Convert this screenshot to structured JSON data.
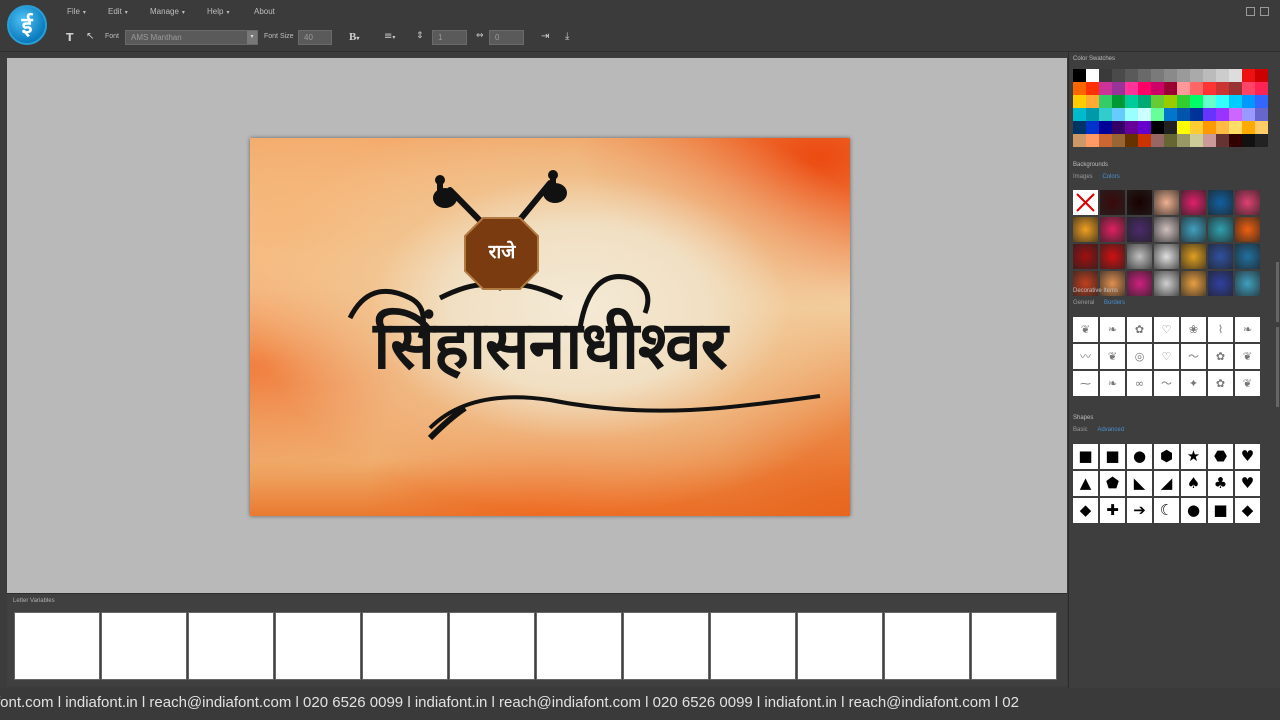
{
  "app": {
    "logo_glyph": "ई",
    "menu": [
      "File",
      "Edit",
      "Manage",
      "Help",
      "About"
    ]
  },
  "toolbar": {
    "text_tool_icon": "text-tool-icon",
    "pointer_tool_icon": "pointer-icon",
    "font_label": "Font",
    "font_value": "AMS Manthan",
    "font_size_label": "Font Size",
    "font_size_value": "40",
    "bold_label": "B",
    "line_spacing_value": "1",
    "letter_spacing_value": "0"
  },
  "design": {
    "emblem_text": "राजे",
    "title_text": "सिंहासनाधीश्वर"
  },
  "letter_variables": {
    "label": "Letter Variables",
    "cells": [
      "",
      "",
      "",
      "",
      "",
      "",
      "",
      "",
      "",
      "",
      "",
      ""
    ]
  },
  "panel": {
    "color_swatches_title": "Color Swatches",
    "backgrounds_title": "Backgrounds",
    "backgrounds_tab_active": "Images",
    "backgrounds_tab_link": "Colors",
    "decorative_title": "Decorative Items",
    "decorative_tab_active": "General",
    "decorative_tab_link": "Borders",
    "shapes_title": "Shapes",
    "shapes_tab_active": "Basic",
    "shapes_tab_link": "Advanced",
    "swatches": [
      "#000000",
      "#ffffff",
      "#3a3a3a",
      "#4a4a4a",
      "#5a5a5a",
      "#6a6a6a",
      "#7a7a7a",
      "#8a8a8a",
      "#9a9a9a",
      "#aaaaaa",
      "#bbbbbb",
      "#cccccc",
      "#dddddd",
      "#ee1111",
      "#cc0000",
      "#ff6600",
      "#ff3300",
      "#cc3399",
      "#993399",
      "#ff3399",
      "#ff0066",
      "#cc0066",
      "#990033",
      "#ff9999",
      "#ff6666",
      "#ff3333",
      "#cc3333",
      "#993333",
      "#ff4466",
      "#ff2255",
      "#ffcc00",
      "#ffaa33",
      "#33cc66",
      "#009933",
      "#00cc99",
      "#00aa77",
      "#66cc33",
      "#99cc00",
      "#33cc33",
      "#00ff66",
      "#66ffcc",
      "#33ffff",
      "#00ccff",
      "#0099ff",
      "#3366ff",
      "#00bbcc",
      "#0099aa",
      "#33cccc",
      "#66ccff",
      "#99ffff",
      "#ccffff",
      "#66ff99",
      "#0077cc",
      "#0055aa",
      "#003399",
      "#6633ff",
      "#9933ff",
      "#cc66ff",
      "#9999ff",
      "#6666cc",
      "#003366",
      "#0033cc",
      "#000099",
      "#330066",
      "#660099",
      "#6600cc",
      "#000000",
      "#222222",
      "#ffff00",
      "#ffcc33",
      "#ff9900",
      "#ffbb44",
      "#ffdd66",
      "#ffaa00",
      "#ffcc66",
      "#cc9966",
      "#ff9966",
      "#cc6633",
      "#996633",
      "#663300",
      "#cc3300",
      "#996666",
      "#666633",
      "#999966",
      "#cccc99",
      "#cc9999",
      "#663333",
      "#330000",
      "#111111",
      "#222222"
    ],
    "background_tiles": [
      "none",
      "#3a0a0a",
      "#1a0000",
      "#f0b090",
      "#e0206a",
      "#1060a0",
      "#e04070",
      "#f0a020",
      "#e02060",
      "#4a2a6a",
      "#d0c0c0",
      "#40a0c0",
      "#30a0b0",
      "#f06010",
      "#a01010",
      "#d01010",
      "#c0c0c0",
      "#e0e0e0",
      "#e0a020",
      "#3050a0",
      "#2070a0",
      "#c04020",
      "#e09050",
      "#d02080",
      "#d0d0d0",
      "#e8a040",
      "#3040a0",
      "#40a0c0"
    ],
    "decorative_glyphs": [
      "❦",
      "❧",
      "✿",
      "♡",
      "❀",
      "⌇",
      "❧",
      "〰",
      "❦",
      "◎",
      "♡",
      "〜",
      "✿",
      "❦",
      "⁓",
      "❧",
      "∞",
      "〜",
      "✦",
      "✿",
      "❦"
    ],
    "shape_glyphs": [
      "■",
      "■",
      "●",
      "⬢",
      "★",
      "⬣",
      "♥",
      "▲",
      "⬟",
      "◣",
      "◢",
      "♠",
      "♣",
      "♥",
      "◆",
      "✚",
      "➔",
      "☾",
      "●",
      "■",
      "◆"
    ]
  },
  "ticker": {
    "text": "font.com l indiafont.in l reach@indiafont.com l 020 6526 0099 l indiafont.in l reach@indiafont.com l 020 6526 0099 l indiafont.in l reach@indiafont.com l 02"
  }
}
